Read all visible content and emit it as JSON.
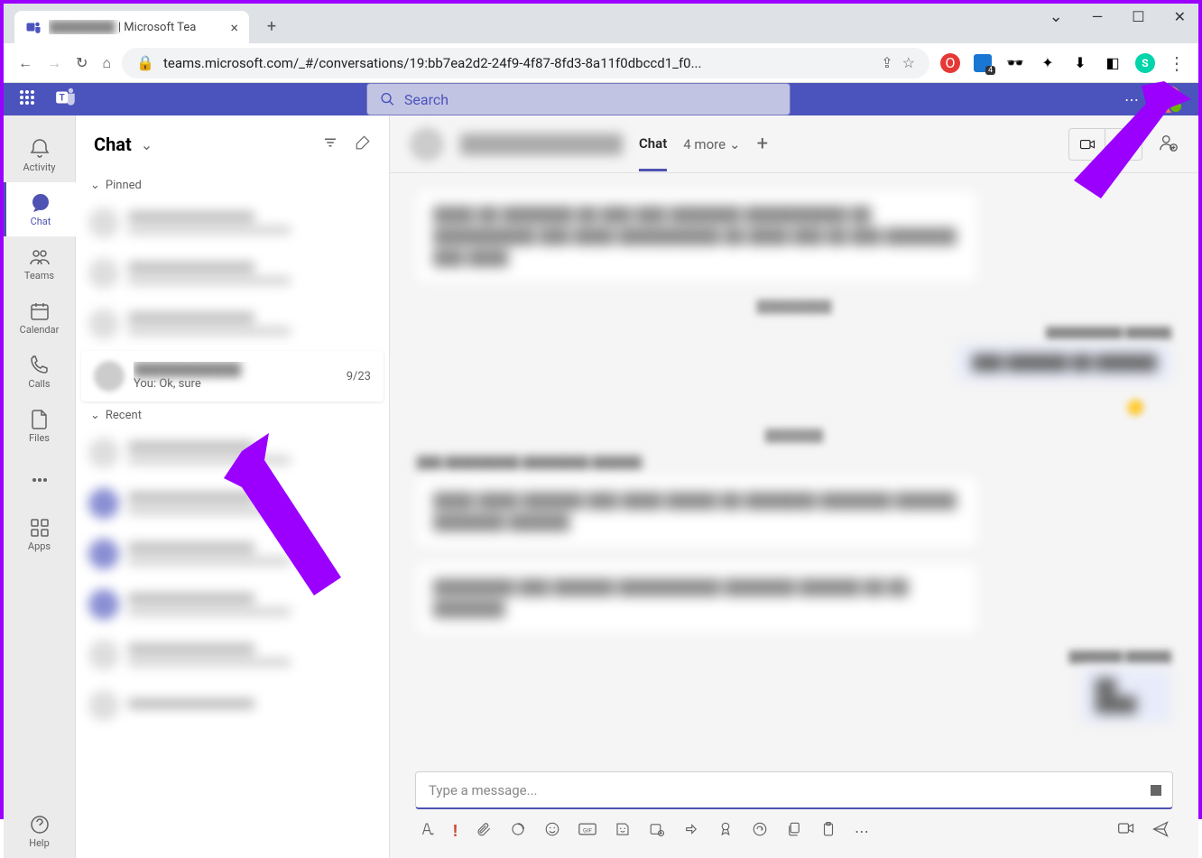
{
  "browser": {
    "tab_title_suffix": " | Microsoft Tea",
    "url": "teams.microsoft.com/_#/conversations/19:bb7ea2d2-24f9-4f87-8fd3-8a11f0dbccd1_f0...",
    "extension_badge": "4"
  },
  "teams_header": {
    "search_placeholder": "Search"
  },
  "rail": {
    "activity": "Activity",
    "chat": "Chat",
    "teams": "Teams",
    "calendar": "Calendar",
    "calls": "Calls",
    "files": "Files",
    "apps": "Apps",
    "help": "Help"
  },
  "chat_panel": {
    "title": "Chat",
    "pinned_label": "Pinned",
    "recent_label": "Recent",
    "selected_chat": {
      "preview": "You: Ok, sure",
      "date": "9/23"
    }
  },
  "chat_main": {
    "tab_chat": "Chat",
    "tab_more": "4 more",
    "compose_placeholder": "Type a message..."
  }
}
